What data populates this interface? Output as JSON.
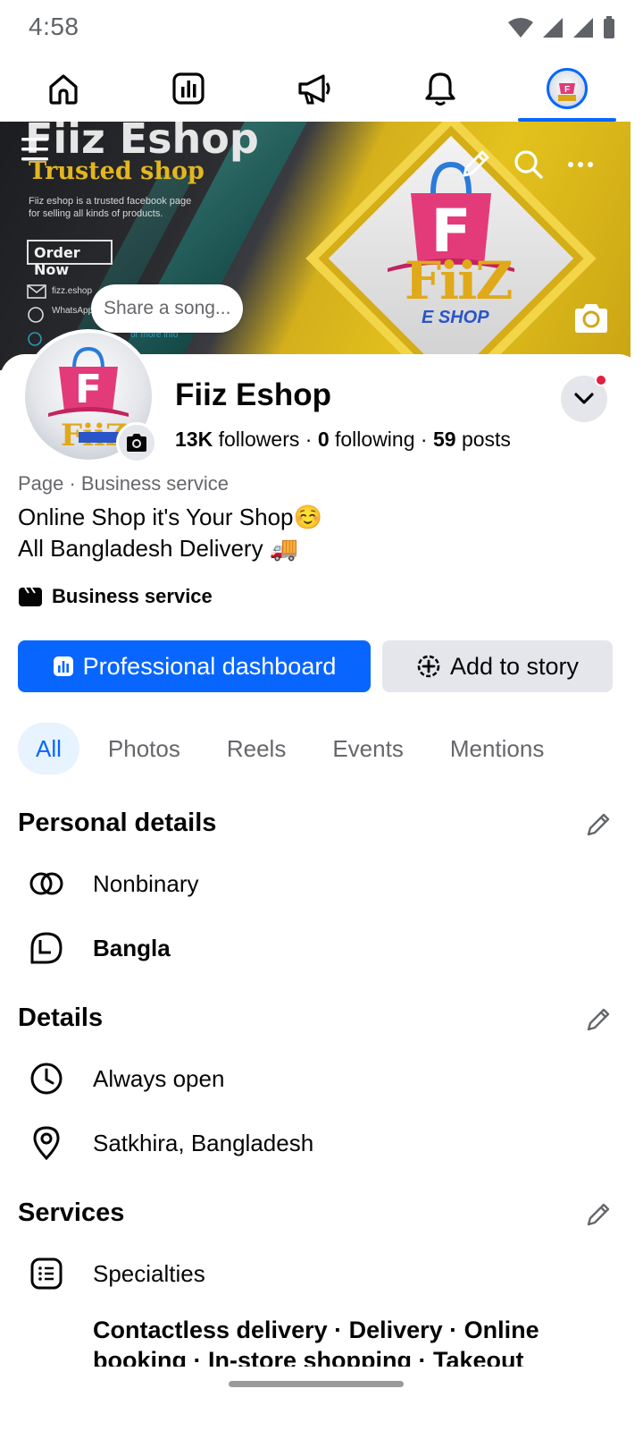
{
  "status_bar": {
    "time": "4:58"
  },
  "cover": {
    "title": "Fiiz Eshop",
    "tagline": "Trusted shop",
    "description": "Fiiz eshop is a trusted facebook page for selling all kinds of products.",
    "order_button": "Order Now",
    "email_line": "fizz.eshop",
    "whatsapp_line": "WhatsApp",
    "more_info": "or more info",
    "logo_text": "FiiZ",
    "logo_subtext": "E SHOP",
    "share_song": "Share a song..."
  },
  "profile": {
    "name": "Fiiz Eshop",
    "followers_count": "13K",
    "followers_label": "followers",
    "following_count": "0",
    "following_label": "following",
    "posts_count": "59",
    "posts_label": "posts",
    "separator": "·",
    "category_line": "Page · Business service",
    "bio_line1": "Online Shop it's Your Shop☺️",
    "bio_line2": "All Bangladesh Delivery 🚚",
    "business_label": "Business service"
  },
  "actions": {
    "dashboard_label": "Professional dashboard",
    "story_label": "Add to story"
  },
  "tabs": [
    {
      "label": "All",
      "active": true
    },
    {
      "label": "Photos",
      "active": false
    },
    {
      "label": "Reels",
      "active": false
    },
    {
      "label": "Events",
      "active": false
    },
    {
      "label": "Mentions",
      "active": false
    }
  ],
  "personal_details": {
    "title": "Personal details",
    "gender": "Nonbinary",
    "language": "Bangla"
  },
  "details": {
    "title": "Details",
    "hours": "Always open",
    "location": "Satkhira, Bangladesh"
  },
  "services": {
    "title": "Services",
    "specialties_label": "Specialties",
    "list": "Contactless delivery · Delivery · Online booking · In-store shopping · Takeout"
  },
  "colors": {
    "accent": "#0866ff",
    "secondary_button": "#e4e6eb",
    "muted_text": "#65676b",
    "notification_dot": "#e41e3f"
  },
  "icons": {
    "nav": [
      "home-icon",
      "dashboard-icon",
      "megaphone-icon",
      "bell-icon",
      "profile-avatar"
    ],
    "cover": [
      "menu-icon",
      "edit-pencil-icon",
      "search-icon",
      "more-icon",
      "camera-icon"
    ]
  }
}
